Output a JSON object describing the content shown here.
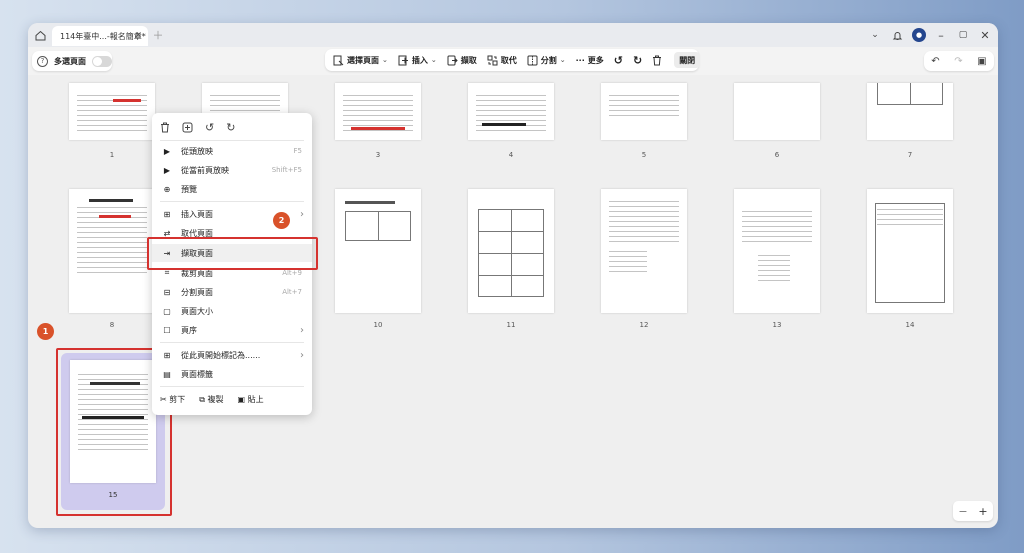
{
  "tab": {
    "title": "114年臺中...-報名簡章*"
  },
  "toolbar": {
    "multi_select_label": "多選頁面",
    "select_page_label": "選擇頁面",
    "insert_label": "插入",
    "extract_label": "擷取",
    "replace_label": "取代",
    "split_label": "分割",
    "more_label": "更多",
    "close_label": "關閉"
  },
  "pages": {
    "top_labels": [
      "1",
      "3",
      "4",
      "5",
      "6",
      "7"
    ],
    "mid_labels": [
      "8",
      "10",
      "11",
      "12",
      "13",
      "14"
    ],
    "selected_label": "15"
  },
  "context_menu": {
    "items": [
      {
        "label": "從頭放映",
        "shortcut": "F5"
      },
      {
        "label": "從當前頁放映",
        "shortcut": "Shift+F5"
      },
      {
        "label": "預覽"
      },
      {
        "label": "插入頁面"
      },
      {
        "label": "取代頁面"
      },
      {
        "label": "擷取頁面"
      },
      {
        "label": "裁剪頁面",
        "shortcut": "Alt+9"
      },
      {
        "label": "分割頁面",
        "shortcut": "Alt+7"
      },
      {
        "label": "頁面大小"
      },
      {
        "label": "頁序"
      },
      {
        "label": "從此頁開始標記為......"
      },
      {
        "label": "頁面標籤"
      }
    ],
    "cut_label": "剪下",
    "copy_label": "複製",
    "paste_label": "貼上"
  },
  "annotations": {
    "badge_1": "1",
    "badge_2": "2"
  },
  "colors": {
    "accent": "#d5322f",
    "badge": "#d9522a",
    "selected_card": "#cfcbee"
  }
}
